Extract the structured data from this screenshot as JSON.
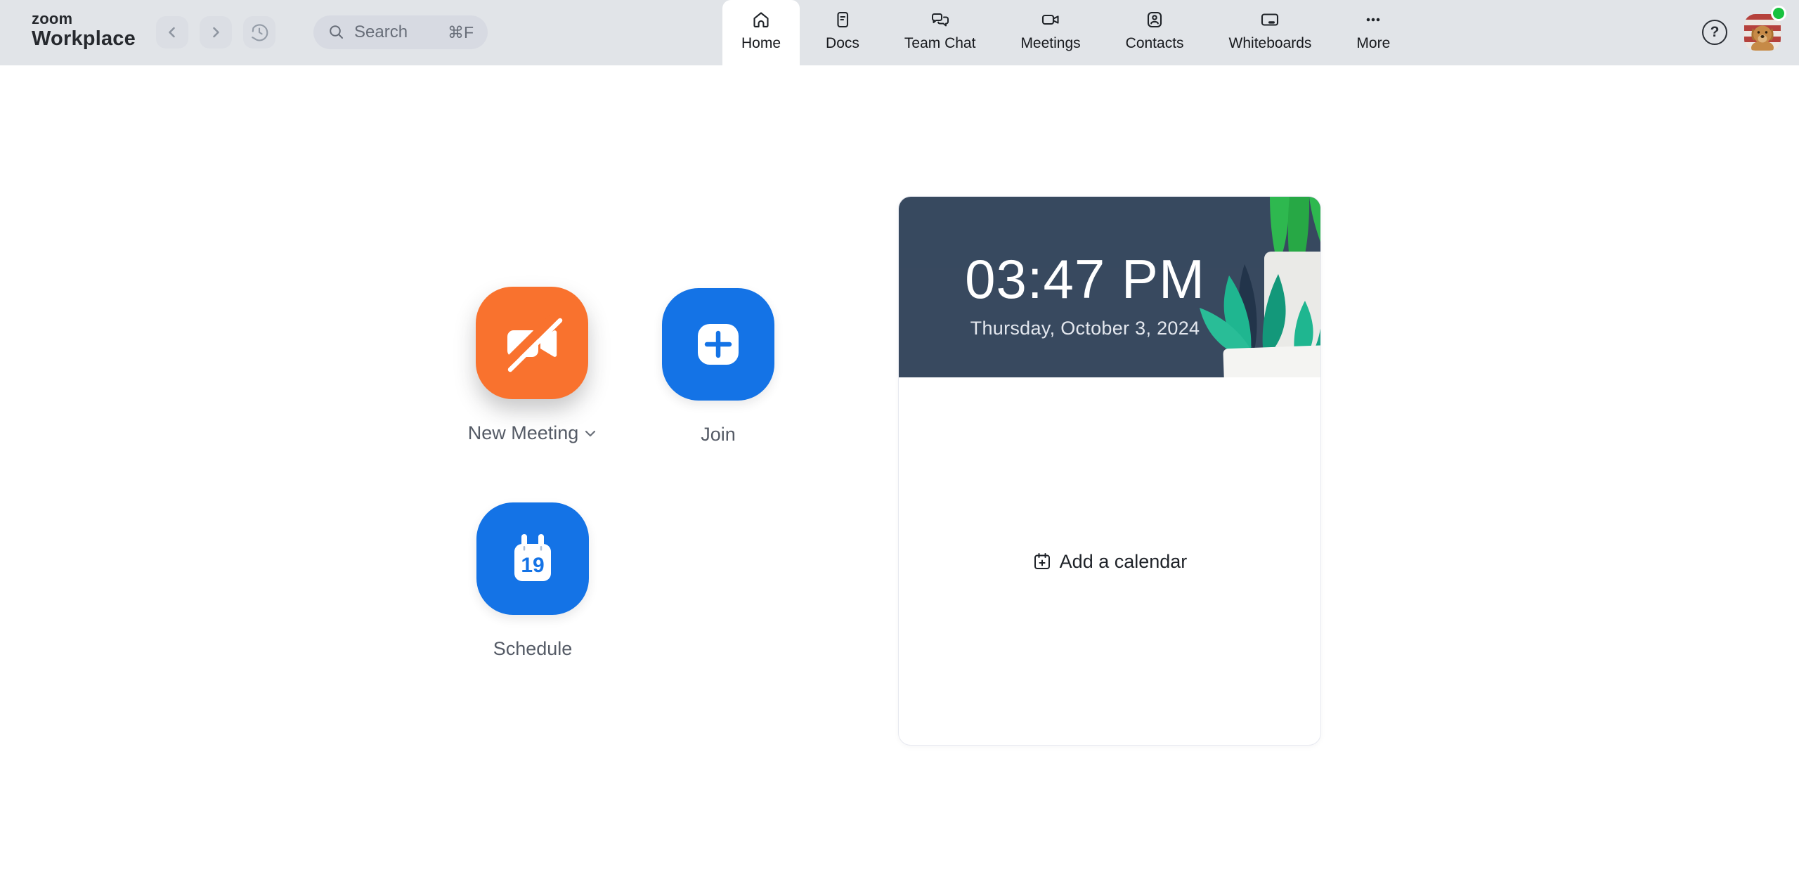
{
  "app": {
    "logo_top": "zoom",
    "logo_bottom": "Workplace"
  },
  "topbar": {
    "search": {
      "placeholder": "Search",
      "shortcut": "⌘F"
    },
    "tabs": [
      {
        "label": "Home",
        "active": true
      },
      {
        "label": "Docs",
        "active": false
      },
      {
        "label": "Team Chat",
        "active": false
      },
      {
        "label": "Meetings",
        "active": false
      },
      {
        "label": "Contacts",
        "active": false
      },
      {
        "label": "Whiteboards",
        "active": false
      },
      {
        "label": "More",
        "active": false
      }
    ],
    "help_glyph": "?"
  },
  "actions": {
    "new_meeting": {
      "label": "New Meeting",
      "color": "#F9722E",
      "has_dropdown": true
    },
    "join": {
      "label": "Join",
      "color": "#1473E6"
    },
    "schedule": {
      "label": "Schedule",
      "color": "#1473E6",
      "calendar_day": "19"
    }
  },
  "clock_card": {
    "time": "03:47 PM",
    "date": "Thursday, October 3, 2024",
    "add_calendar_label": "Add a calendar"
  },
  "user": {
    "presence": "available",
    "presence_color": "#18C23F"
  },
  "colors": {
    "topbar_bg": "#E1E4E8",
    "content_bg": "#FFFFFF",
    "card_hero_bg": "#2F4158",
    "leaf_teal": "#1FB690",
    "leaf_green": "#2EB84F"
  }
}
